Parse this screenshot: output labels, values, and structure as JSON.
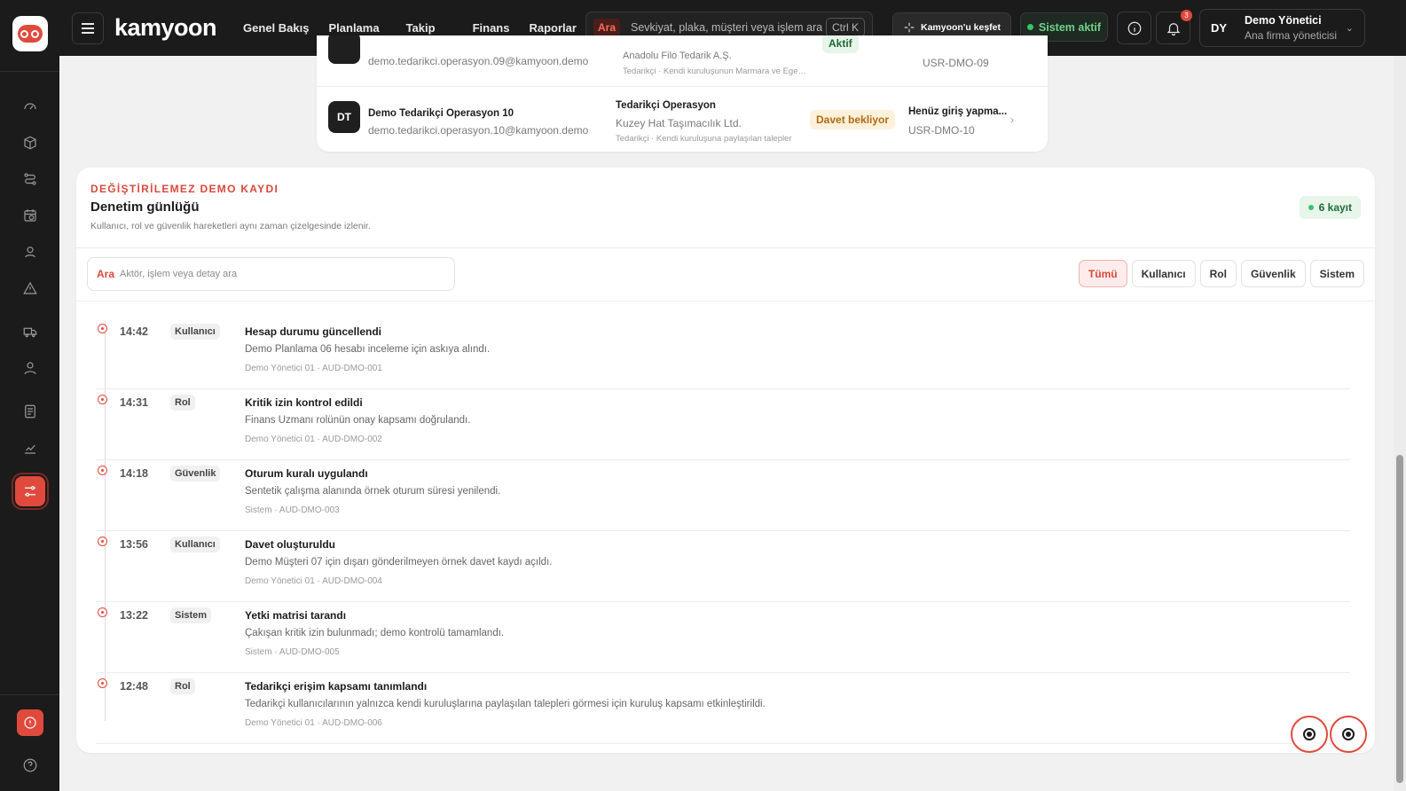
{
  "app": {
    "brand": "kamyoon"
  },
  "nav": {
    "items": [
      "Genel Bakış",
      "Planlama",
      "Takip",
      "Finans",
      "Raporlar"
    ]
  },
  "search": {
    "tag": "Ara",
    "placeholder": "Sevkiyat, plaka, müşteri veya işlem ara",
    "shortcut": "Ctrl K"
  },
  "topbar": {
    "discover_label": "Kamyoon'u keşfet",
    "status_label": "Sistem aktif",
    "notification_count": "3"
  },
  "user": {
    "initials": "DY",
    "name": "Demo Yönetici",
    "role": "Ana firma yöneticisi"
  },
  "users_table": {
    "rows": [
      {
        "email": "demo.tedarikci.operasyon.09@kamyoon.demo",
        "org": "Anadolu Filo Tedarik A.Ş.",
        "scope": "Tedarikçi · Kendi kuruluşunun Marmara ve Ege…",
        "status": "Aktif",
        "id": "USR-DMO-09"
      },
      {
        "initials": "DT",
        "name": "Demo Tedarikçi Operasyon 10",
        "email": "demo.tedarikci.operasyon.10@kamyoon.demo",
        "role": "Tedarikçi Operasyon",
        "org": "Kuzey Hat Taşımacılık Ltd.",
        "scope": "Tedarikçi · Kendi kuruluşuna paylaşılan talepler",
        "status": "Davet bekliyor",
        "last_login": "Henüz giriş yapma...",
        "id": "USR-DMO-10"
      }
    ]
  },
  "audit": {
    "eyebrow": "DEĞİŞTİRİLEMEZ DEMO KAYDI",
    "title": "Denetim günlüğü",
    "subtitle": "Kullanıcı, rol ve güvenlik hareketleri aynı zaman çizelgesinde izlenir.",
    "count": "6 kayıt",
    "search_tag": "Ara",
    "search_placeholder": "Aktör, işlem veya detay ara",
    "filters": [
      "Tümü",
      "Kullanıcı",
      "Rol",
      "Güvenlik",
      "Sistem"
    ],
    "entries": [
      {
        "time": "14:42",
        "type": "Kullanıcı",
        "title": "Hesap durumu güncellendi",
        "desc": "Demo Planlama 06 hesabı inceleme için askıya alındı.",
        "meta": "Demo Yönetici 01 · AUD-DMO-001"
      },
      {
        "time": "14:31",
        "type": "Rol",
        "title": "Kritik izin kontrol edildi",
        "desc": "Finans Uzmanı rolünün onay kapsamı doğrulandı.",
        "meta": "Demo Yönetici 01 · AUD-DMO-002"
      },
      {
        "time": "14:18",
        "type": "Güvenlik",
        "title": "Oturum kuralı uygulandı",
        "desc": "Sentetik çalışma alanında örnek oturum süresi yenilendi.",
        "meta": "Sistem · AUD-DMO-003"
      },
      {
        "time": "13:56",
        "type": "Kullanıcı",
        "title": "Davet oluşturuldu",
        "desc": "Demo Müşteri 07 için dışarı gönderilmeyen örnek davet kaydı açıldı.",
        "meta": "Demo Yönetici 01 · AUD-DMO-004"
      },
      {
        "time": "13:22",
        "type": "Sistem",
        "title": "Yetki matrisi tarandı",
        "desc": "Çakışan kritik izin bulunmadı; demo kontrolü tamamlandı.",
        "meta": "Sistem · AUD-DMO-005"
      },
      {
        "time": "12:48",
        "type": "Rol",
        "title": "Tedarikçi erişim kapsamı tanımlandı",
        "desc": "Tedarikçi kullanıcılarının yalnızca kendi kuruluşlarına paylaşılan talepleri görmesi için kuruluş kapsamı etkinleştirildi.",
        "meta": "Demo Yönetici 01 · AUD-DMO-006"
      }
    ]
  },
  "colors": {
    "accent": "#e04a3d",
    "dark": "#1b1b1b",
    "success": "#3cc26a"
  }
}
